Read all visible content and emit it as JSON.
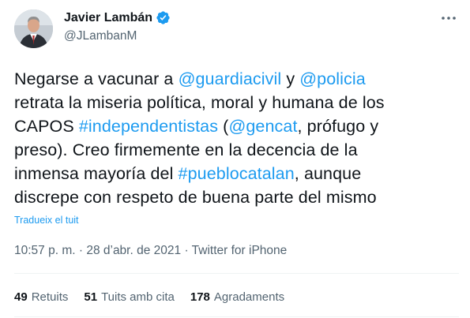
{
  "author": {
    "name": "Javier Lambán",
    "handle": "@JLambanM",
    "verified": true
  },
  "tweet": {
    "lines": [
      [
        {
          "t": "Negarse a vacunar a ",
          "link": false
        },
        {
          "t": "@guardiacivil",
          "link": true
        },
        {
          "t": " y ",
          "link": false
        },
        {
          "t": "@policia",
          "link": true
        }
      ],
      [
        {
          "t": "retrata la miseria política, moral y humana de los",
          "link": false
        }
      ],
      [
        {
          "t": "CAPOS ",
          "link": false
        },
        {
          "t": "#independentistas",
          "link": true
        },
        {
          "t": " (",
          "link": false
        },
        {
          "t": "@gencat",
          "link": true
        },
        {
          "t": ", prófugo y",
          "link": false
        }
      ],
      [
        {
          "t": "preso). Creo firmemente en la decencia de la",
          "link": false
        }
      ],
      [
        {
          "t": "inmensa mayoría del ",
          "link": false
        },
        {
          "t": "#pueblocatalan",
          "link": true
        },
        {
          "t": ", aunque",
          "link": false
        }
      ],
      [
        {
          "t": "discrepe con respeto de buena parte del mismo",
          "link": false
        }
      ]
    ],
    "translate_label": "Tradueix el tuit"
  },
  "meta": {
    "time": "10:57 p. m.",
    "date": "28 d’abr. de 2021",
    "source": "Twitter for iPhone",
    "separator": "·"
  },
  "stats": [
    {
      "count": "49",
      "label": "Retuits"
    },
    {
      "count": "51",
      "label": "Tuits amb cita"
    },
    {
      "count": "178",
      "label": "Agradaments"
    }
  ],
  "colors": {
    "link": "#1d9bf0",
    "secondary": "#536471",
    "text": "#0f1419",
    "verified": "#1d9bf0"
  },
  "icons": {
    "verified": "verified-badge-icon",
    "more": "more-options-icon"
  }
}
